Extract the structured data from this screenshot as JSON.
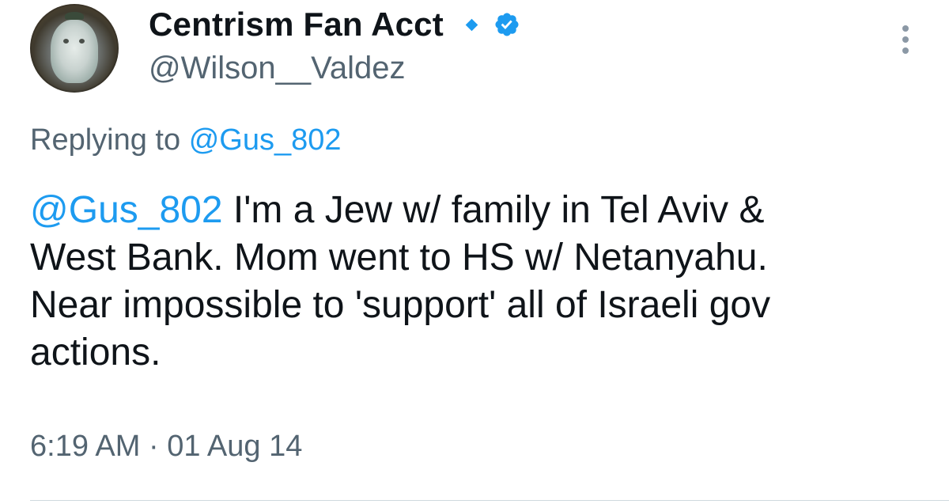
{
  "author": {
    "display_name": "Centrism Fan Acct",
    "handle": "@Wilson__Valdez",
    "avatar_icon": "profile-photo",
    "badges": [
      "diamond-icon",
      "verified-badge-icon"
    ]
  },
  "reply": {
    "prefix": "Replying to",
    "to_handle": "@Gus_802"
  },
  "body": {
    "mention": "@Gus_802",
    "line1_rest": " I'm a Jew w/ family in Tel Aviv &",
    "line2": "West Bank. Mom went to HS w/ Netanyahu.",
    "line3": "Near impossible to 'support' all of Israeli gov",
    "line4": "actions."
  },
  "meta": {
    "time": "6:19 AM",
    "separator": " · ",
    "date": "01 Aug 14"
  },
  "menu": {
    "icon": "more-options-icon"
  },
  "colors": {
    "link": "#1d9bf0",
    "secondary_text": "#536471",
    "primary_text": "#0f1419",
    "divider": "#cfd9de"
  }
}
